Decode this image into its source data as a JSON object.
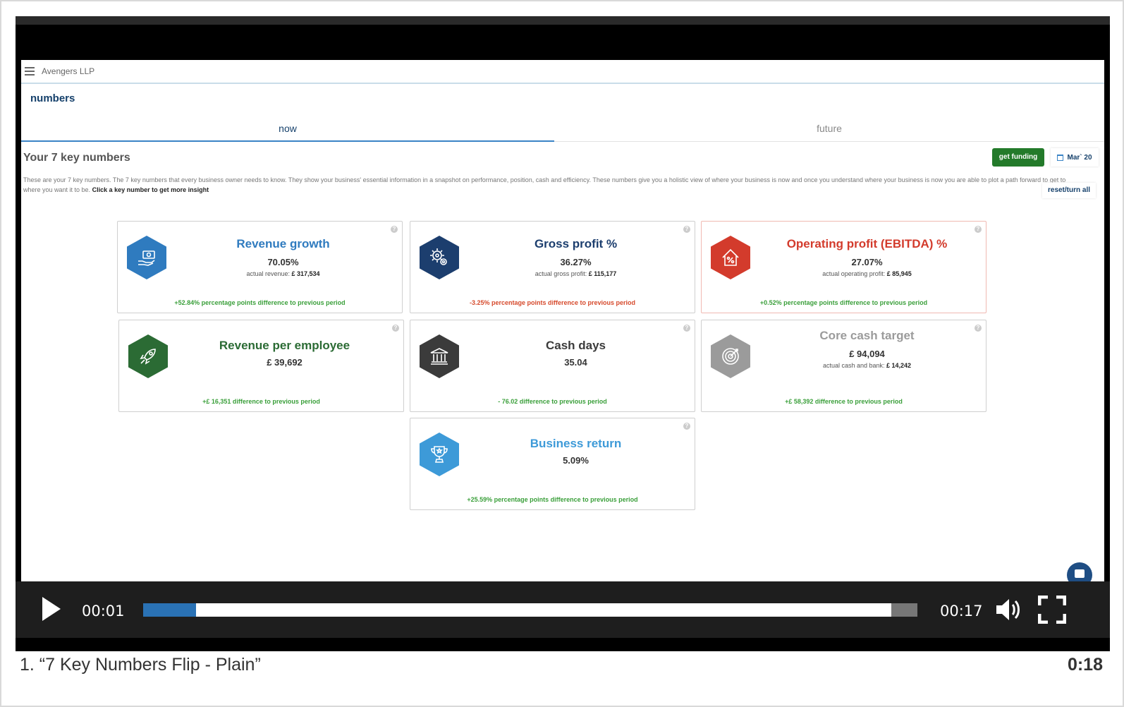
{
  "app": {
    "company": "Avengers LLP",
    "page_title": "numbers"
  },
  "tabs": [
    {
      "label": "now"
    },
    {
      "label": "future"
    }
  ],
  "section": {
    "heading": "Your 7 key numbers",
    "fund_label": "get funding",
    "date_label": "Mar` 20",
    "intro": "These are your 7 key numbers. The 7 key numbers that every business owner needs to know. They show your business' essential information in a snapshot on performance, position, cash and efficiency. These numbers give you a holistic view of where your business is now and once you understand where your business is now you are able to plot a path forward to get to where you want it to be.",
    "intro_cta": "Click a key number to get more insight",
    "reset_label": "reset/turn all"
  },
  "cards": [
    {
      "title": "Revenue growth",
      "value": "70.05%",
      "sub_label": "actual revenue:",
      "sub_value": "£ 317,534",
      "diff": "+52.84% percentage points difference to previous period",
      "diff_type": "pos",
      "color": "#2f7bbf",
      "icon": "money-hand-icon"
    },
    {
      "title": "Gross profit %",
      "value": "36.27%",
      "sub_label": "actual gross profit:",
      "sub_value": "£ 115,177",
      "diff": "-3.25% percentage points difference to previous period",
      "diff_type": "neg",
      "color": "#1c3e6e",
      "icon": "gears-icon"
    },
    {
      "title": "Operating profit (EBITDA) %",
      "value": "27.07%",
      "sub_label": "actual operating profit:",
      "sub_value": "£ 85,945",
      "diff": "+0.52% percentage points difference to previous period",
      "diff_type": "pos",
      "color": "#d33b2c",
      "icon": "house-percent-icon"
    },
    {
      "title": "Revenue per employee",
      "value": "£ 39,692",
      "sub_label": "",
      "sub_value": "",
      "diff": "+£ 16,351 difference to previous period",
      "diff_type": "pos",
      "color": "#2b6b34",
      "icon": "rocket-icon"
    },
    {
      "title": "Cash days",
      "value": "35.04",
      "sub_label": "",
      "sub_value": "",
      "diff": "- 76.02 difference to previous period",
      "diff_type": "pos",
      "color": "#3b3b3b",
      "icon": "bank-icon"
    },
    {
      "title": "Core cash target",
      "value": "£ 94,094",
      "sub_label": "actual cash and bank:",
      "sub_value": "£ 14,242",
      "diff": "+£ 58,392 difference to previous period",
      "diff_type": "pos",
      "color": "#9b9b9b",
      "icon": "target-icon"
    },
    {
      "title": "Business return",
      "value": "5.09%",
      "sub_label": "",
      "sub_value": "",
      "diff": "+25.59% percentage points difference to previous period",
      "diff_type": "pos",
      "color": "#3d9ad8",
      "icon": "trophy-icon"
    }
  ],
  "player": {
    "current_time": "00:01",
    "duration_time": "00:17",
    "progress": 0.068
  },
  "video": {
    "caption": "1. “7 Key Numbers Flip - Plain”",
    "length": "0:18"
  }
}
